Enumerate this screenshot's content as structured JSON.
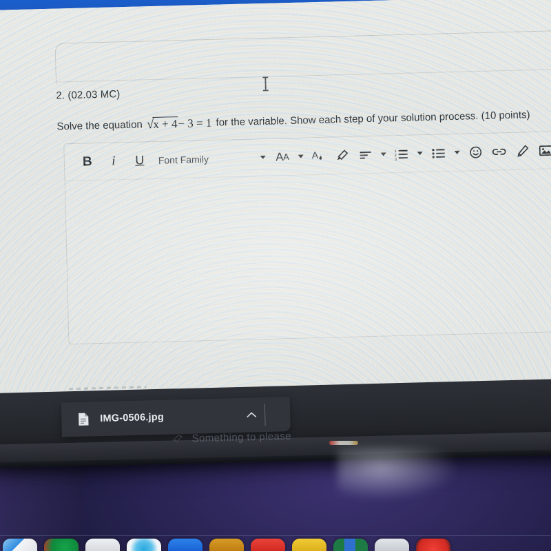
{
  "question": {
    "number_label": "2. (02.03 MC)",
    "prompt_before": "Solve the equation",
    "equation": {
      "radical_symbol": "√",
      "radicand": "x + 4",
      "rest": "− 3 = 1",
      "plain": "√(x+4) − 3 = 1"
    },
    "prompt_after": "for the variable. Show each step of your solution process. (10 points)"
  },
  "editor": {
    "toolbar": {
      "bold_label": "B",
      "italic_label": "i",
      "underline_label": "U",
      "font_family_label": "Font Family",
      "font_size_label_big": "A",
      "font_size_label_small": "A",
      "text_color_label": "A",
      "icons": {
        "bold": "bold-icon",
        "italic": "italic-icon",
        "underline": "underline-icon",
        "font_family_caret": "chevron-down-icon",
        "font_size_caret": "chevron-down-icon",
        "text_color": "text-color-icon",
        "highlighter": "highlighter-icon",
        "align": "align-left-icon",
        "align_caret": "chevron-down-icon",
        "numbered_list": "numbered-list-icon",
        "numbered_list_caret": "chevron-down-icon",
        "bullet_list": "bullet-list-icon",
        "bullet_list_caret": "chevron-down-icon",
        "emoji": "emoji-smiley-icon",
        "link": "link-icon",
        "draw": "pencil-draw-icon",
        "image": "image-icon",
        "video": "video-play-icon"
      }
    },
    "body_text": "",
    "cursor": "text-ibeam-cursor"
  },
  "status": {
    "clock_icon": "clock-icon"
  },
  "download_bar": {
    "file_icon": "file-document-icon",
    "file_name": "IMG-0506.jpg",
    "expand_icon": "chevron-up-icon"
  },
  "laptop": {
    "hinge_text": "Something to please",
    "hinge_logo_icon": "sticker-icon"
  },
  "dock": {
    "items": [
      {
        "name": "finder",
        "color": "#2f8ce0"
      },
      {
        "name": "app-green-red",
        "color": "#16a34a"
      },
      {
        "name": "launchpad",
        "color": "#dfe2e6"
      },
      {
        "name": "safari",
        "color": "#f2f5f8"
      },
      {
        "name": "app-blue",
        "color": "#1d6fe0"
      },
      {
        "name": "app-orange",
        "color": "#c98a1a"
      },
      {
        "name": "app-red",
        "color": "#e0352c"
      },
      {
        "name": "app-yellow",
        "color": "#e6c02a"
      },
      {
        "name": "app-excel",
        "color": "#1e7a45"
      },
      {
        "name": "app-white",
        "color": "#cfd3d8"
      },
      {
        "name": "app-red-circle",
        "color": "#e03a32"
      }
    ]
  },
  "colors": {
    "blue_bar": "#1a5fcd",
    "download_bar": "#31353b",
    "page_surface": "#e6eaea",
    "wallpaper": "#2e2558"
  }
}
